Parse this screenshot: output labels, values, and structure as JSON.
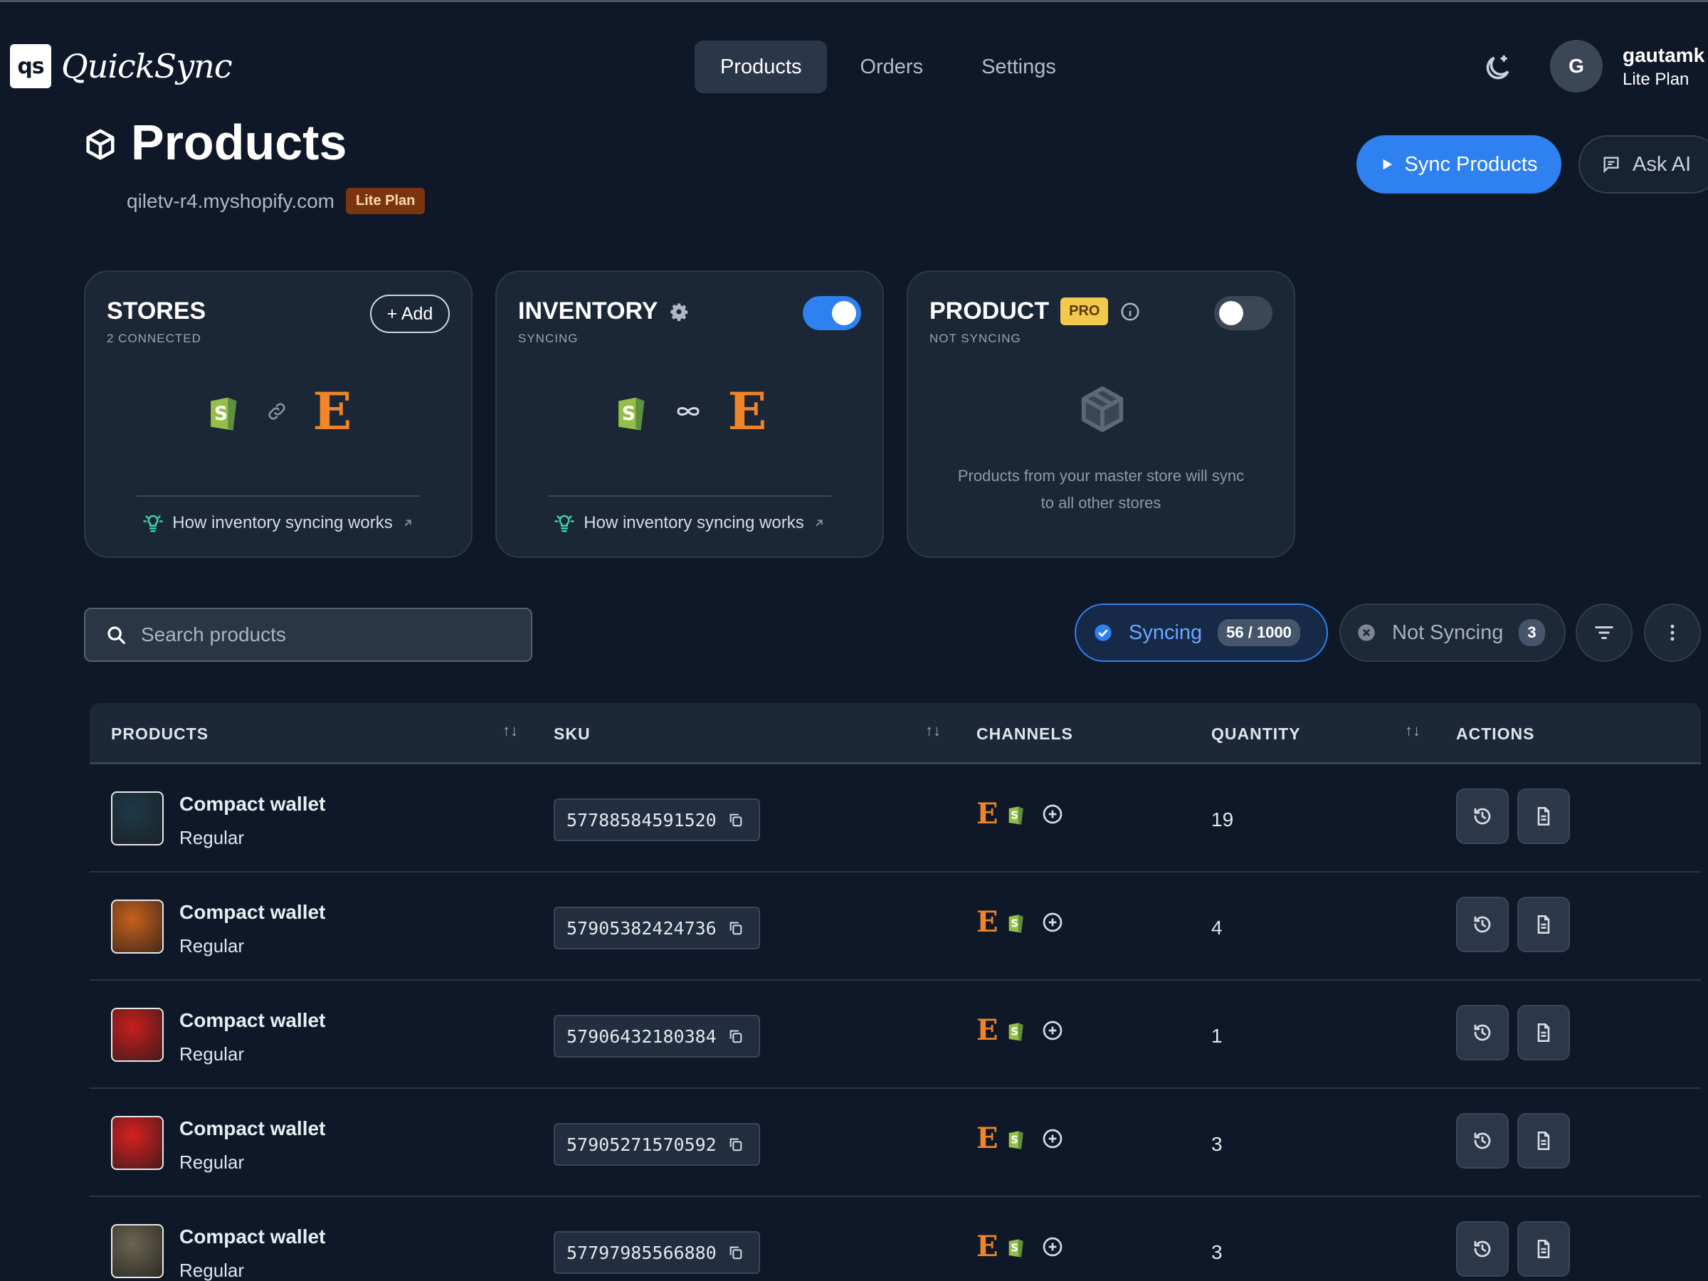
{
  "app": {
    "logo_mark": "qs",
    "name": "QuickSync"
  },
  "nav": {
    "tabs": [
      {
        "label": "Products"
      },
      {
        "label": "Orders"
      },
      {
        "label": "Settings"
      }
    ],
    "active": "Products"
  },
  "user": {
    "initial": "G",
    "name": "gautamk",
    "plan": "Lite Plan"
  },
  "page": {
    "title": "Products",
    "domain": "qiletv-r4.myshopify.com",
    "plan_badge": "Lite Plan",
    "sync_button": "Sync Products",
    "ask_button": "Ask AI"
  },
  "cards": {
    "stores": {
      "title": "STORES",
      "subtitle": "2 CONNECTED",
      "add_label": "+ Add",
      "how_label": "How inventory syncing works"
    },
    "inventory": {
      "title": "INVENTORY",
      "subtitle": "SYNCING",
      "toggle_on": true,
      "how_label": "How inventory syncing works"
    },
    "product": {
      "title": "PRODUCT",
      "badge": "PRO",
      "subtitle": "NOT SYNCING",
      "toggle_on": false,
      "message": "Products from your master store will sync to all other stores"
    }
  },
  "filters": {
    "search_placeholder": "Search products",
    "syncing": {
      "label": "Syncing",
      "count": "56 / 1000"
    },
    "not_syncing": {
      "label": "Not Syncing",
      "count": "3"
    }
  },
  "table": {
    "headers": {
      "products": "PRODUCTS",
      "sku": "SKU",
      "channels": "CHANNELS",
      "quantity": "QUANTITY",
      "actions": "ACTIONS"
    },
    "rows": [
      {
        "name": "Compact wallet",
        "variant": "Regular",
        "sku": "57788584591520",
        "quantity": "19",
        "channel_etsy": "E",
        "thumb_color": "#1e3a4a"
      },
      {
        "name": "Compact wallet",
        "variant": "Regular",
        "sku": "57905382424736",
        "quantity": "4",
        "channel_etsy": "E",
        "thumb_color": "#c7611b"
      },
      {
        "name": "Compact wallet",
        "variant": "Regular",
        "sku": "57906432180384",
        "quantity": "1",
        "channel_etsy": "E",
        "thumb_color": "#c81e1e"
      },
      {
        "name": "Compact wallet",
        "variant": "Regular",
        "sku": "57905271570592",
        "quantity": "3",
        "channel_etsy": "E",
        "thumb_color": "#d82020"
      },
      {
        "name": "Compact wallet",
        "variant": "Regular",
        "sku": "57797985566880",
        "quantity": "3",
        "channel_etsy": "E",
        "thumb_color": "#6b6550"
      }
    ]
  },
  "colors": {
    "accent": "#2f80f0",
    "etsy": "#f08426",
    "shopify": "#95bf47",
    "plan_badge": "#7a3410",
    "pro_badge": "#f2c94c"
  },
  "icons": [
    "moon-icon",
    "cube-icon",
    "play-icon",
    "chat-icon",
    "shopify-icon",
    "etsy-icon",
    "link-icon",
    "infinity-icon",
    "lightbulb-icon",
    "external-link-icon",
    "gear-icon",
    "info-icon",
    "search-icon",
    "check-circle-icon",
    "x-circle-icon",
    "filter-icon",
    "more-vertical-icon",
    "sort-icon",
    "copy-icon",
    "add-circle-icon",
    "history-icon",
    "document-icon"
  ]
}
